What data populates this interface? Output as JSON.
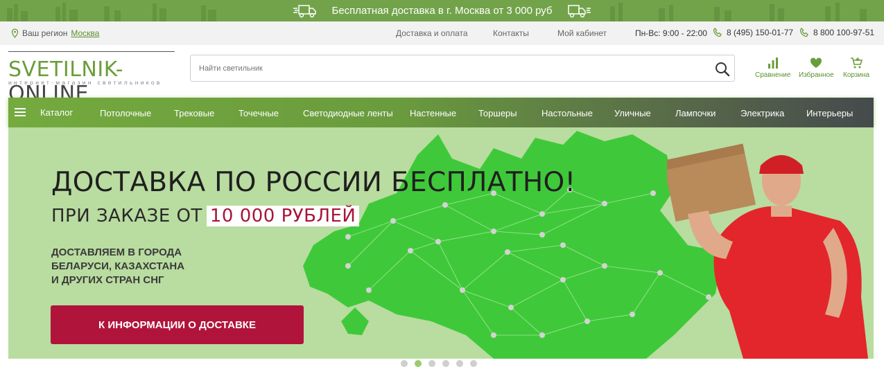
{
  "promo": {
    "text": "Бесплатная доставка в г. Москва от 3 000 руб"
  },
  "topbar": {
    "region_label": "Ваш регион",
    "region_city": "Москва",
    "links": [
      "Доставка и оплата",
      "Контакты",
      "Мой кабинет"
    ],
    "hours": "Пн-Вс: 9:00 - 22:00",
    "phones": [
      "8 (495) 150-01-77",
      "8 800 100-97-51"
    ]
  },
  "logo": {
    "name_left": "SVETILNIK-",
    "name_right": "ONLINE",
    "subtitle": "интернет-магазин светильников"
  },
  "search": {
    "placeholder": "Найти светильник"
  },
  "header_icons": {
    "compare": "Сравнение",
    "favorites": "Избранное",
    "cart": "Корзина"
  },
  "nav": {
    "catalog": "Каталог",
    "items": [
      "Потолочные",
      "Трековые",
      "Точечные",
      "Светодиодные ленты",
      "Настенные",
      "Торшеры",
      "Настольные",
      "Уличные",
      "Лампочки",
      "Электрика",
      "Интерьеры"
    ]
  },
  "banner": {
    "headline": "ДОСТАВКА ПО РОССИИ БЕСПЛАТНО!",
    "sub_prefix": "ПРИ ЗАКАЗЕ ОТ",
    "sub_highlight": "10 000 РУБЛЕЙ",
    "cities": "ДОСТАВЛЯЕМ В ГОРОДА\nБЕЛАРУСИ, КАЗАХСТАНА\nИ ДРУГИХ СТРАН СНГ",
    "cta": "К ИНФОРМАЦИИ О ДОСТАВКЕ"
  },
  "slider": {
    "count": 6,
    "active": 2
  },
  "colors": {
    "brand_green": "#72a34a",
    "accent_red": "#b0143b",
    "map_green": "#3fc93a"
  }
}
